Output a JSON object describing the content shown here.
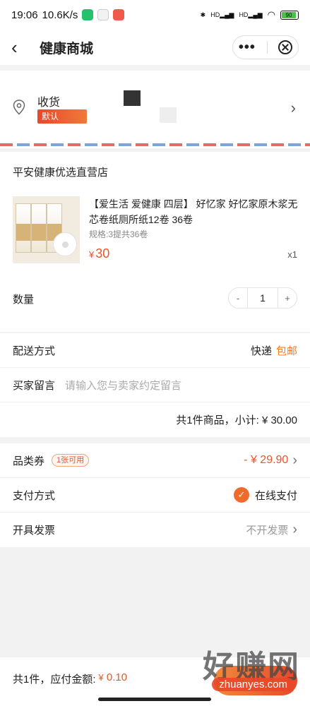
{
  "status": {
    "time": "19:06",
    "speed": "10.6K/s",
    "battery": "90",
    "colors": {
      "app1": "#25c26e",
      "app2": "#f2f2f2",
      "app3": "#f05a4a"
    }
  },
  "nav": {
    "title": "健康商城",
    "back_icon": "chevron-left-icon",
    "more_icon": "more-dots-icon",
    "close_icon": "close-circle-icon"
  },
  "address": {
    "label": "收货",
    "default_tag": "默认",
    "icon": "location-pin-icon"
  },
  "shop": {
    "name": "平安健康优选直营店",
    "product": {
      "title": "【爱生活 爱健康 四层】 好忆家 好忆家原木浆无芯卷纸厕所纸12卷 36卷",
      "spec": "规格:3提共36卷",
      "currency": "¥",
      "price": "30",
      "count": "x1"
    },
    "quantity_label": "数量",
    "quantity": {
      "minus": "-",
      "value": "1",
      "plus": "+"
    }
  },
  "order": {
    "delivery_label": "配送方式",
    "delivery_value": "快递",
    "delivery_tag": "包邮",
    "note_label": "买家留言",
    "note_placeholder": "请输入您与卖家约定留言",
    "subtotal": "共1件商品，小计: ¥ 30.00"
  },
  "payment": {
    "coupon_label": "品类券",
    "coupon_tag": "1张可用",
    "coupon_value": "- ¥ 29.90",
    "method_label": "支付方式",
    "method_value": "在线支付",
    "invoice_label": "开具发票",
    "invoice_value": "不开发票"
  },
  "footer": {
    "summary": "共1件，应付金额:",
    "amount_currency": "¥",
    "amount": "0.10"
  },
  "watermark": {
    "brand": "好赚网",
    "url": "zhuanyes.com"
  },
  "accent": "#e8562a"
}
